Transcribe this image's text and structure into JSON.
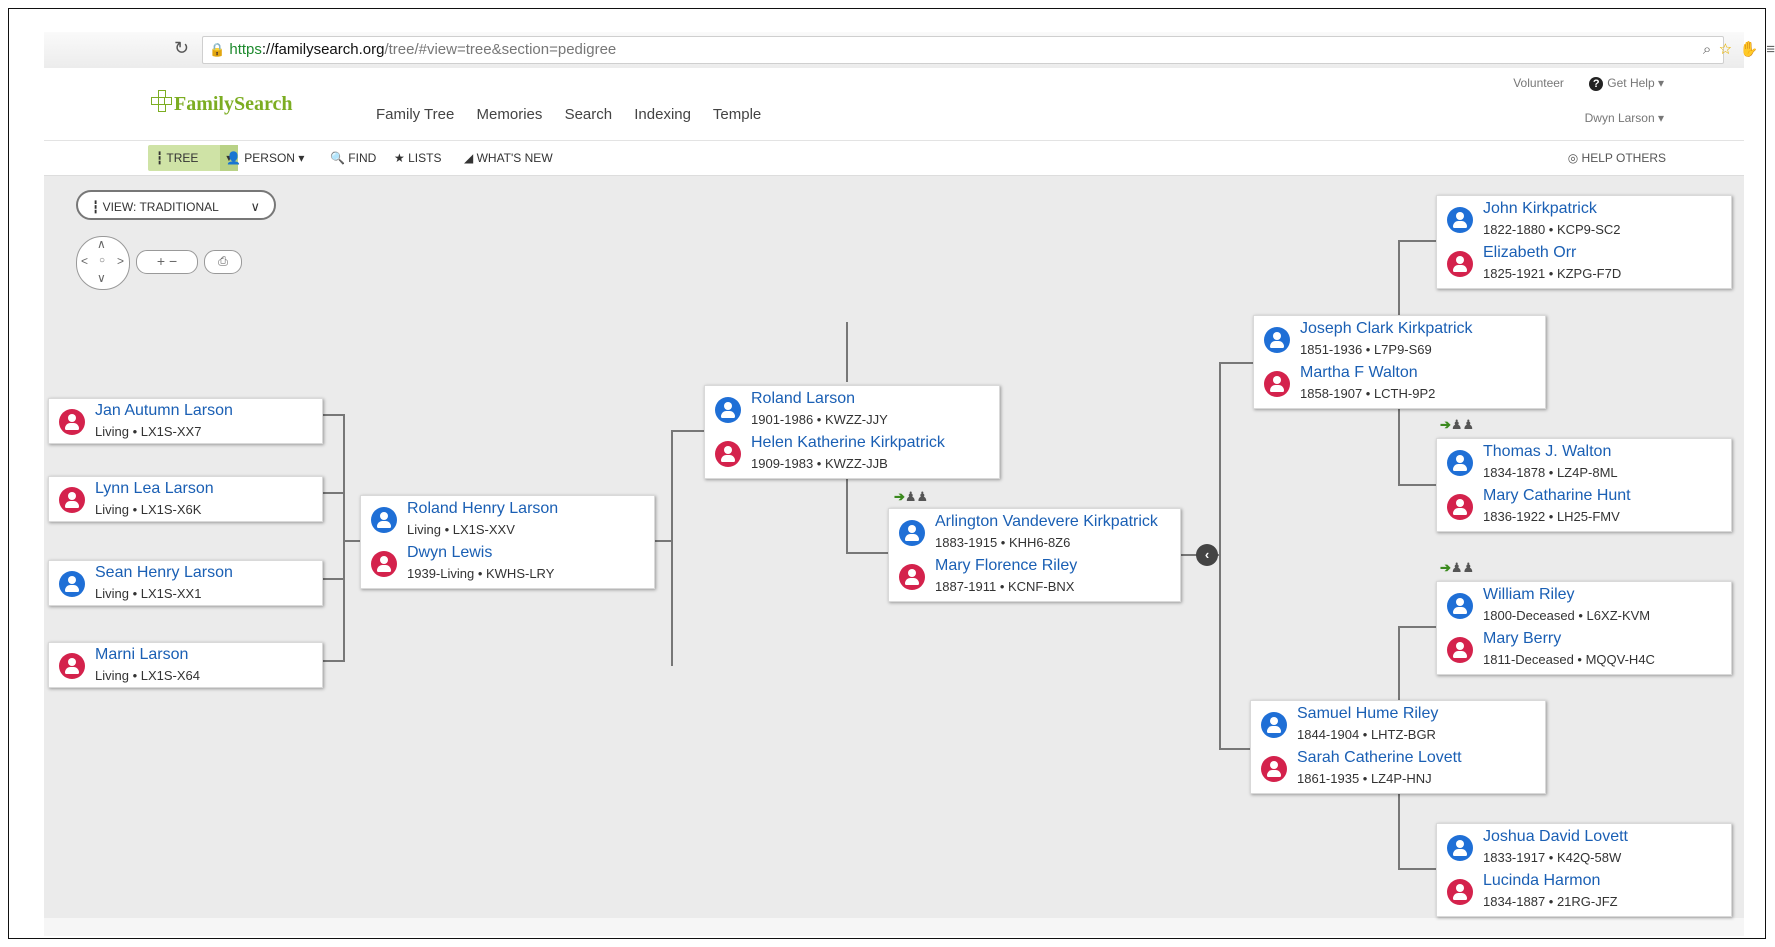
{
  "browser": {
    "reload_icon": "reload-icon",
    "url_https": "https",
    "url_host": "://familysearch.org",
    "url_path": "/tree/#view=tree&section=pedigree"
  },
  "header": {
    "logo_text": "FamilySearch",
    "nav": [
      "Family Tree",
      "Memories",
      "Search",
      "Indexing",
      "Temple"
    ],
    "volunteer": "Volunteer",
    "get_help": "Get Help",
    "user": "Dwyn Larson"
  },
  "toolbar": {
    "tree": "TREE",
    "person": "PERSON",
    "find": "FIND",
    "lists": "LISTS",
    "whats_new": "WHAT'S NEW",
    "help_others": "HELP OTHERS"
  },
  "controls": {
    "view_label": "VIEW: TRADITIONAL",
    "zoom": "+  −"
  },
  "children": [
    {
      "name": "Jan Autumn Larson",
      "meta": "Living  •  LX1S-XX7",
      "gender": "female"
    },
    {
      "name": "Lynn Lea Larson",
      "meta": "Living  •  LX1S-X6K",
      "gender": "female"
    },
    {
      "name": "Sean Henry Larson",
      "meta": "Living  •  LX1S-XX1",
      "gender": "male"
    },
    {
      "name": "Marni Larson",
      "meta": "Living  •  LX1S-X64",
      "gender": "female"
    }
  ],
  "couples": {
    "root": [
      {
        "name": "Roland Henry Larson",
        "meta": "Living  •  LX1S-XXV",
        "gender": "male"
      },
      {
        "name": "Dwyn Lewis",
        "meta": "1939-Living  •  KWHS-LRY",
        "gender": "female"
      }
    ],
    "larson_parents": [
      {
        "name": "Roland Larson",
        "meta": "1901-1986  •  KWZZ-JJY",
        "gender": "male"
      },
      {
        "name": "Helen Katherine Kirkpatrick",
        "meta": "1909-1983  •  KWZZ-JJB",
        "gender": "female"
      }
    ],
    "lewis_parents": [
      {
        "name": "Arlington Vandevere Kirkpatrick",
        "meta": "1883-1915  •  KHH6-8Z6",
        "gender": "male"
      },
      {
        "name": "Mary Florence Riley",
        "meta": "1887-1911  •  KCNF-BNX",
        "gender": "female"
      }
    ],
    "kirkpatrick_parents": [
      {
        "name": "Joseph Clark Kirkpatrick",
        "meta": "1851-1936  •  L7P9-S69",
        "gender": "male"
      },
      {
        "name": "Martha F Walton",
        "meta": "1858-1907  •  LCTH-9P2",
        "gender": "female"
      }
    ],
    "riley_parents": [
      {
        "name": "Samuel Hume Riley",
        "meta": "1844-1904  •  LHTZ-BGR",
        "gender": "male"
      },
      {
        "name": "Sarah Catherine Lovett",
        "meta": "1861-1935  •  LZ4P-HNJ",
        "gender": "female"
      }
    ],
    "jk_parents": [
      {
        "name": "John Kirkpatrick",
        "meta": "1822-1880  •  KCP9-SC2",
        "gender": "male"
      },
      {
        "name": "Elizabeth Orr",
        "meta": "1825-1921  •  KZPG-F7D",
        "gender": "female"
      }
    ],
    "walton_parents": [
      {
        "name": "Thomas J. Walton",
        "meta": "1834-1878  •  LZ4P-8ML",
        "gender": "male"
      },
      {
        "name": "Mary Catharine Hunt",
        "meta": "1836-1922  •  LH25-FMV",
        "gender": "female"
      }
    ],
    "wr_parents": [
      {
        "name": "William Riley",
        "meta": "1800-Deceased  •  L6XZ-KVM",
        "gender": "male"
      },
      {
        "name": "Mary Berry",
        "meta": "1811-Deceased  •  MQQV-H4C",
        "gender": "female"
      }
    ],
    "lovett_parents": [
      {
        "name": "Joshua David Lovett",
        "meta": "1833-1917  •  K42Q-58W",
        "gender": "male"
      },
      {
        "name": "Lucinda Harmon",
        "meta": "1834-1887  •  21RG-JFZ",
        "gender": "female"
      }
    ]
  }
}
